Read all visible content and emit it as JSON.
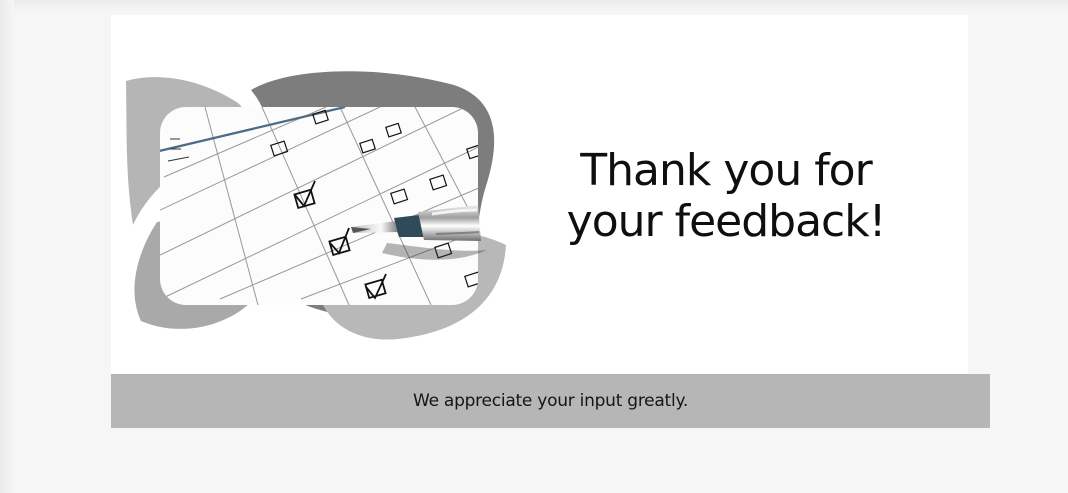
{
  "hero": {
    "title": "Thank you for\nyour feedback!",
    "image_icon": "checklist-pen-image"
  },
  "footer": {
    "message": "We appreciate your input greatly."
  },
  "colors": {
    "background": "#f6f6f6",
    "card": "#ffffff",
    "footer_band": "#b6b6b6",
    "text": "#111111"
  }
}
